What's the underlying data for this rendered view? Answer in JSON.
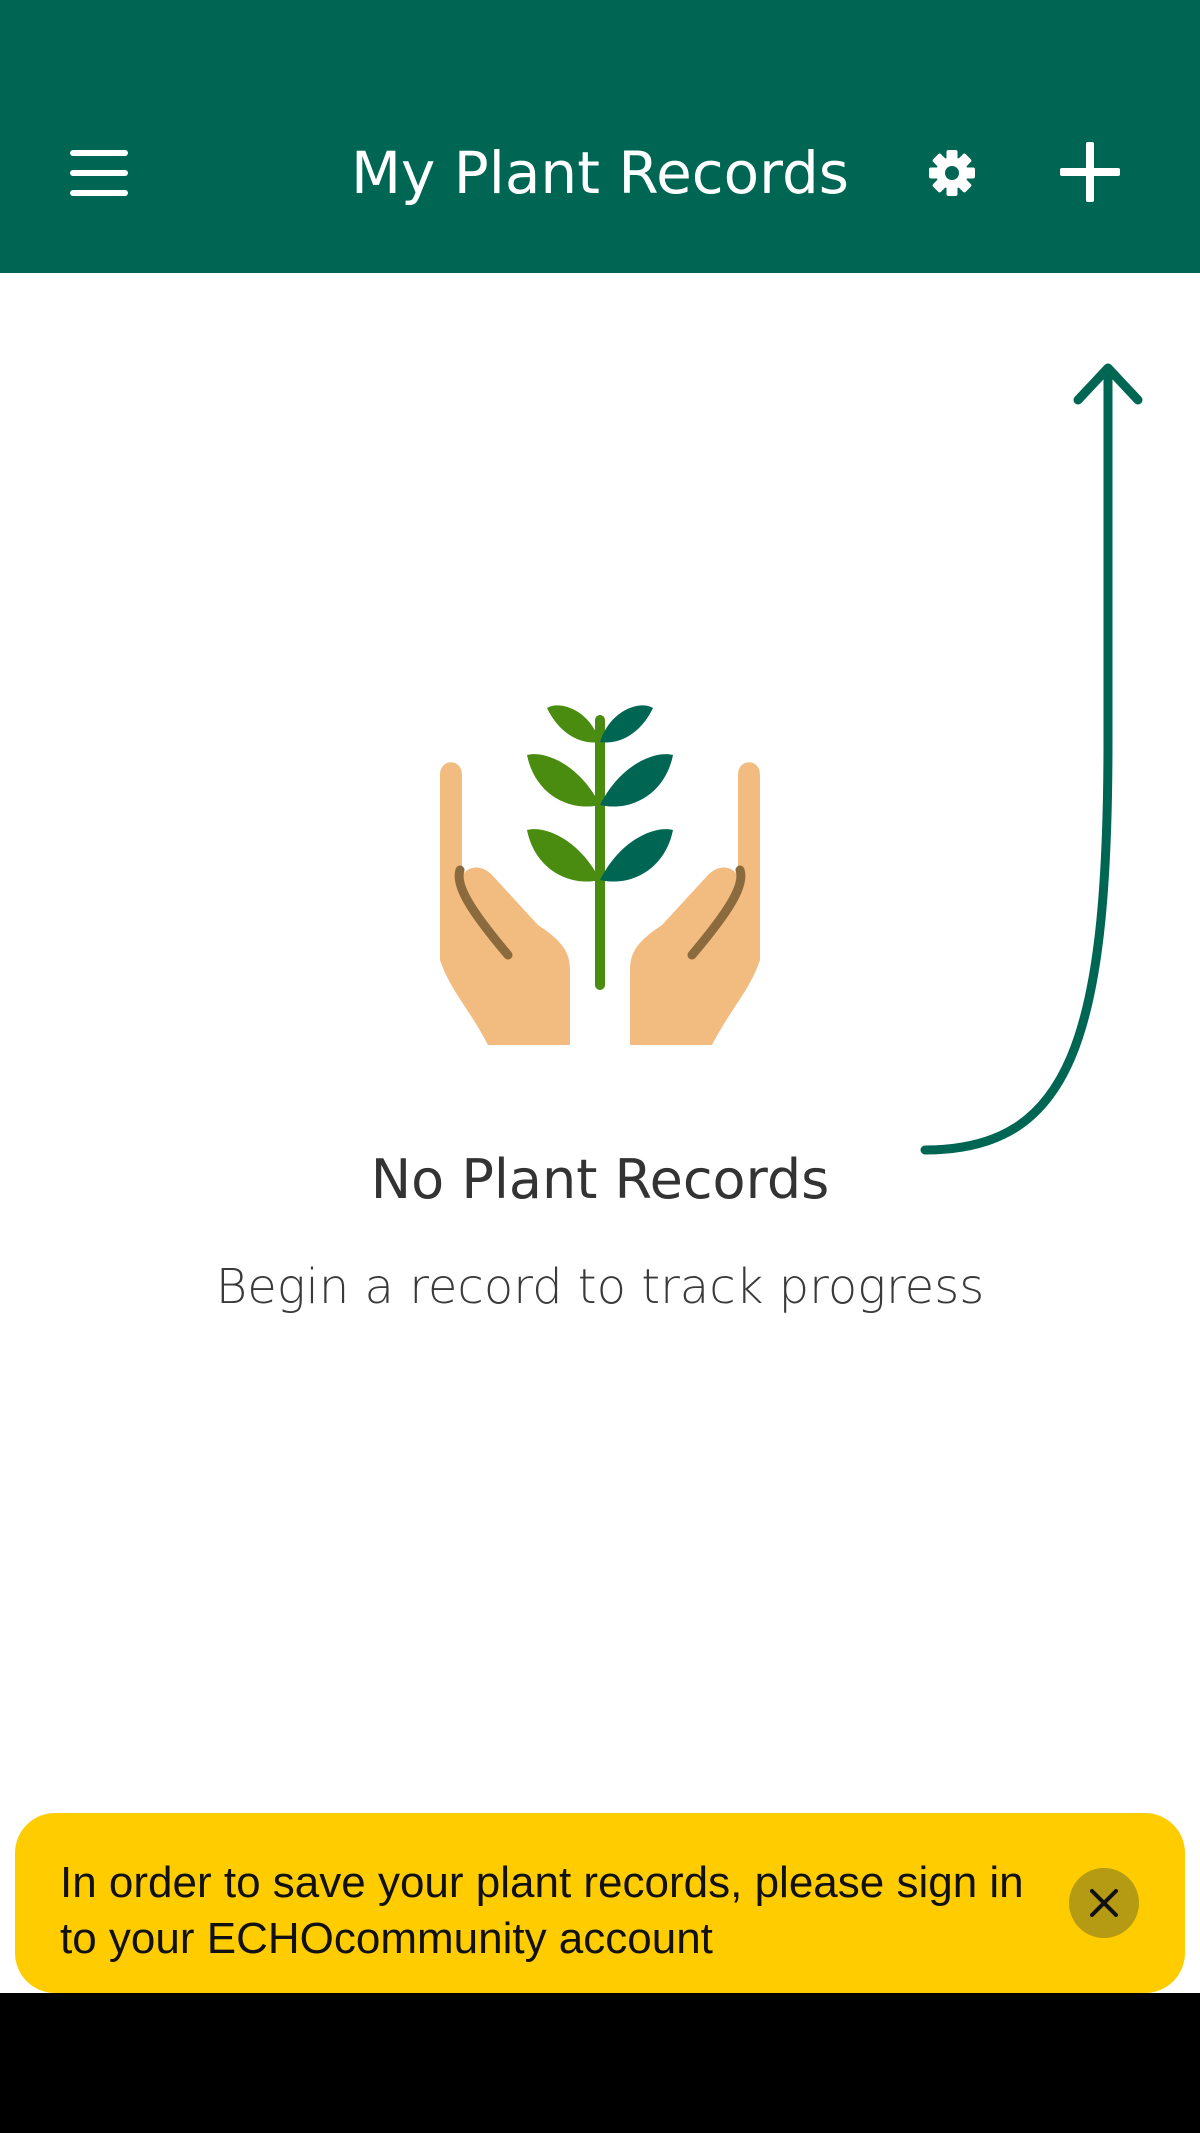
{
  "app_bar": {
    "title": "My Plant Records",
    "menu_icon": "hamburger-menu-icon",
    "settings_icon": "gear-icon",
    "add_icon": "plus-icon"
  },
  "empty_state": {
    "illustration": "hands-holding-plant-illustration",
    "title": "No Plant Records",
    "subtitle": "Begin a record to track progress",
    "hint_icon": "curved-arrow-up-icon"
  },
  "banner": {
    "message": "In order to save your plant records, please sign in to your ECHOcommunity account",
    "close_icon": "close-icon"
  },
  "colors": {
    "primary": "#006654",
    "banner_background": "#ffcc00",
    "leaf_light": "#4a8c0f",
    "leaf_dark": "#006654",
    "hand": "#f2bb80",
    "hand_line": "#8b6a3e"
  }
}
